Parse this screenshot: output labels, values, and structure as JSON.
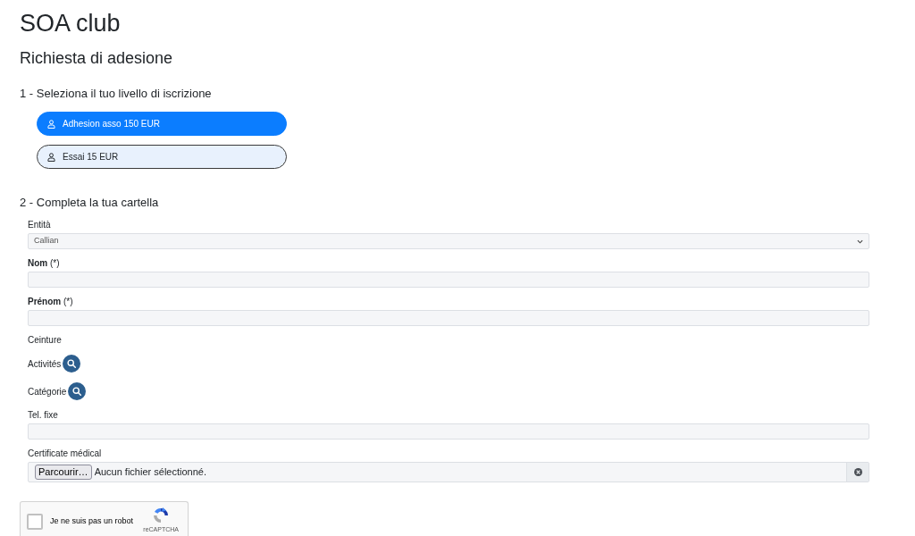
{
  "page": {
    "title": "SOA club",
    "subtitle": "Richiesta di adesione"
  },
  "step_1": {
    "heading": "1 - Seleziona il tuo livello di iscrizione",
    "options": [
      {
        "label": "Adhesion asso 150 EUR",
        "selected": true
      },
      {
        "label": "Essai 15 EUR",
        "selected": false
      }
    ]
  },
  "step_2": {
    "heading": "2 - Completa la tua cartella",
    "fields": [
      {
        "kind": "select",
        "label": "Entità",
        "value": "Callian"
      },
      {
        "kind": "text",
        "label": "**Nom** (*)"
      },
      {
        "kind": "text",
        "label": "**Prénom** (*)"
      },
      {
        "kind": "label",
        "label": "Ceinture"
      },
      {
        "kind": "search",
        "label": "Activités"
      },
      {
        "kind": "search",
        "label": "Catégorie"
      },
      {
        "kind": "text",
        "label": "Tel. fixe"
      },
      {
        "kind": "file",
        "label": "Certificate médical",
        "button": "Parcourir…",
        "value": "Aucun fichier sélectionné."
      }
    ]
  },
  "captcha": {
    "label": "Je ne suis pas un robot",
    "checked": false,
    "brand": "reCAPTCHA"
  }
}
